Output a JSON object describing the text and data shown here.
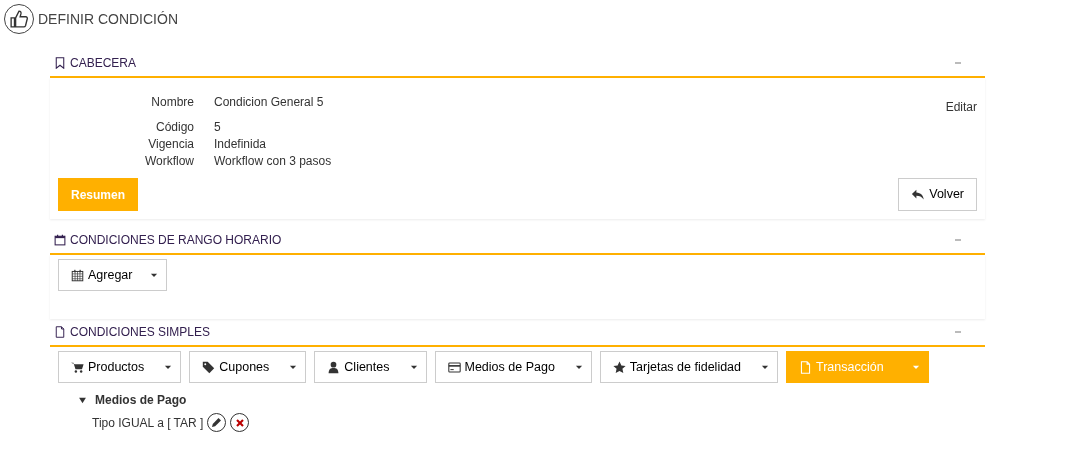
{
  "page_title": "DEFINIR CONDICIÓN",
  "header_panel": {
    "title": "CABECERA",
    "fields": [
      {
        "label": "Nombre",
        "value": "Condicion General 5"
      },
      {
        "label": "Código",
        "value": "5"
      },
      {
        "label": "Vigencia",
        "value": "Indefinida"
      },
      {
        "label": "Workflow",
        "value": "Workflow con 3 pasos"
      }
    ],
    "edit_link": "Editar",
    "summary_button": "Resumen",
    "back_button": "Volver"
  },
  "time_panel": {
    "title": "CONDICIONES DE RANGO HORARIO",
    "add_button": "Agregar"
  },
  "simple_panel": {
    "title": "CONDICIONES SIMPLES",
    "buttons": [
      {
        "label": "Productos",
        "selected": false
      },
      {
        "label": "Cupones",
        "selected": false
      },
      {
        "label": "Clientes",
        "selected": false
      },
      {
        "label": "Medios de Pago",
        "selected": false
      },
      {
        "label": "Tarjetas de fidelidad",
        "selected": false
      },
      {
        "label": "Transacción",
        "selected": true
      }
    ],
    "tree": [
      {
        "label": "Medios de Pago",
        "expanded": true,
        "children": [
          {
            "label": "Tipo IGUAL a [ TAR ]"
          }
        ]
      }
    ]
  }
}
